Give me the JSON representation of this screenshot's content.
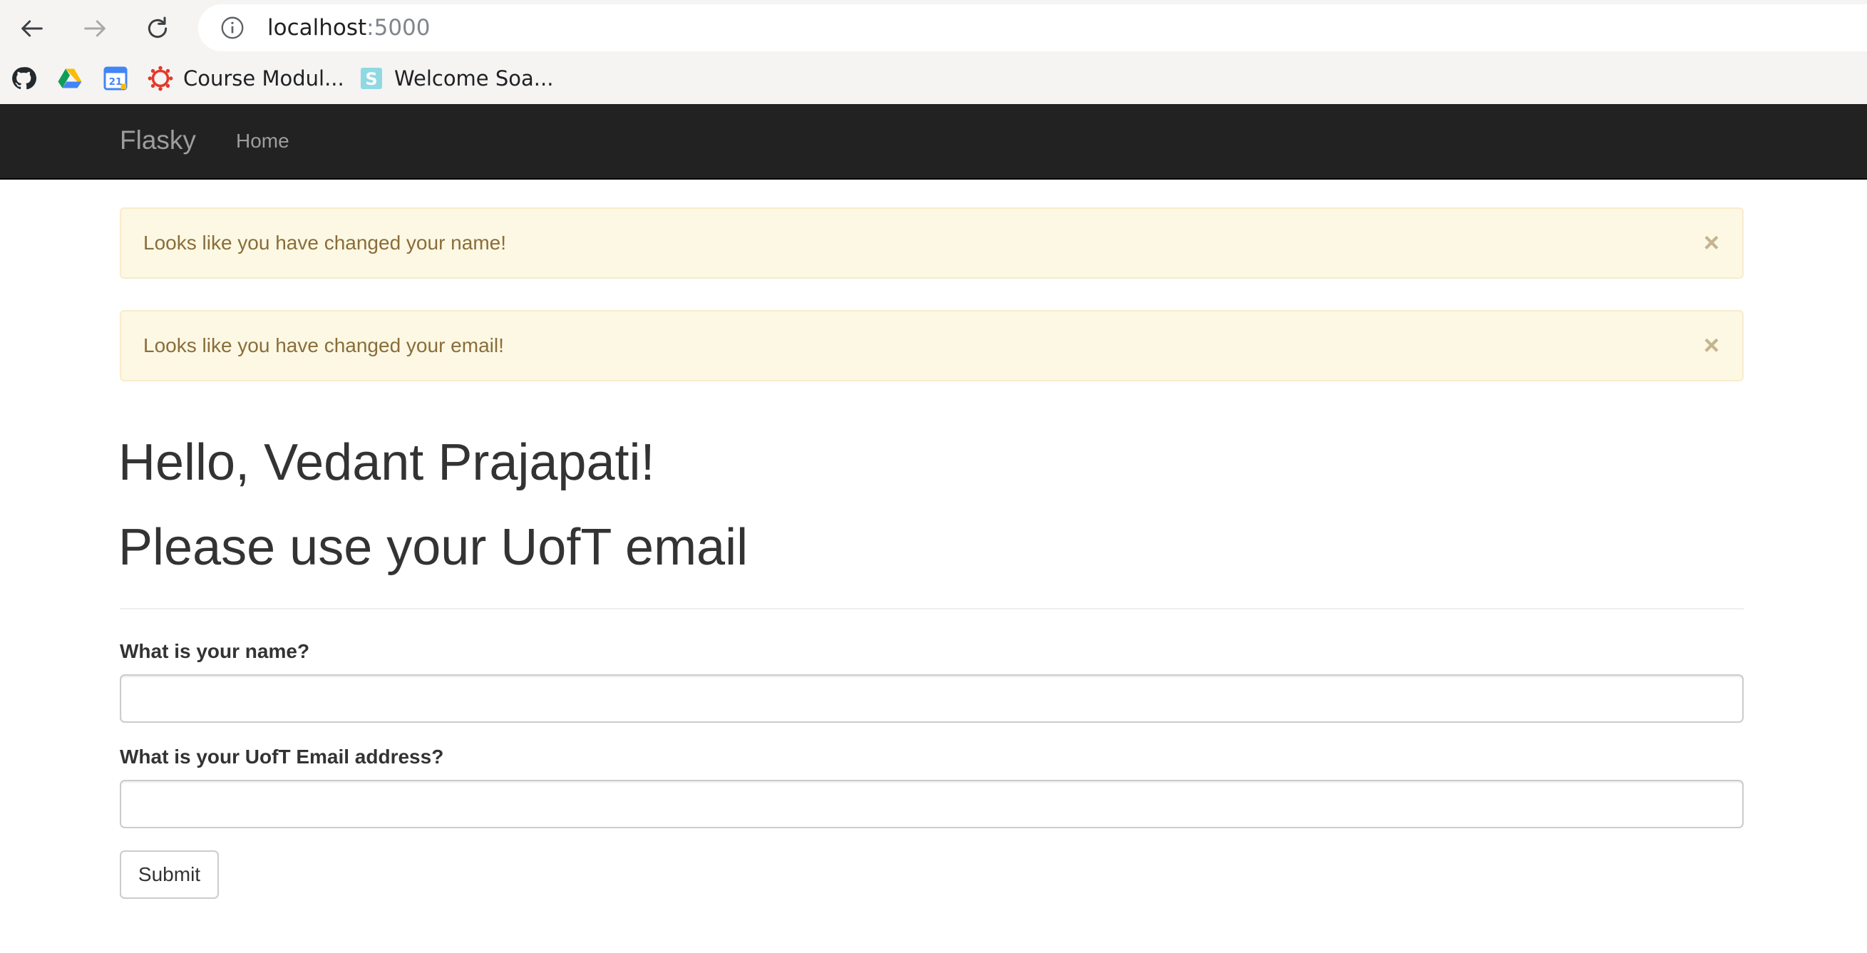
{
  "browser": {
    "url_host": "localhost",
    "url_port": ":5000",
    "bookmarks": [
      {
        "icon": "github-icon",
        "label": ""
      },
      {
        "icon": "google-drive-icon",
        "label": ""
      },
      {
        "icon": "google-calendar-icon",
        "label": "",
        "badge": "21"
      },
      {
        "icon": "canvas-icon",
        "label": "Course Modul..."
      },
      {
        "icon": "soap-s-icon",
        "label": "Welcome Soa...",
        "badge": "S"
      }
    ]
  },
  "navbar": {
    "brand": "Flasky",
    "links": [
      {
        "label": "Home"
      }
    ]
  },
  "alerts": [
    {
      "text": "Looks like you have changed your name!",
      "close": "×"
    },
    {
      "text": "Looks like you have changed your email!",
      "close": "×"
    }
  ],
  "page": {
    "greeting": "Hello, Vedant Prajapati!",
    "subheading": "Please use your UofT email"
  },
  "form": {
    "name_label": "What is your name?",
    "name_value": "",
    "email_label": "What is your UofT Email address?",
    "email_value": "",
    "submit_label": "Submit"
  },
  "colors": {
    "navbar_bg": "#222222",
    "alert_bg": "#fcf8e3",
    "alert_border": "#faebcc",
    "alert_text": "#8a6d3b"
  }
}
